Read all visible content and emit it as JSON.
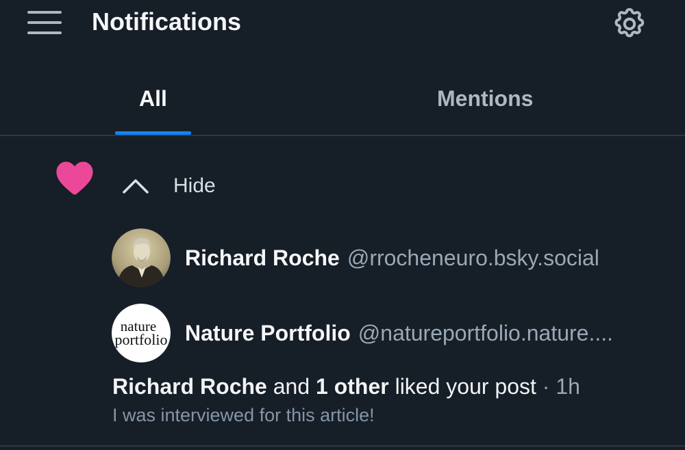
{
  "header": {
    "title": "Notifications",
    "menu_icon": "hamburger-menu-icon",
    "settings_icon": "gear-icon"
  },
  "tabs": [
    {
      "label": "All",
      "active": true
    },
    {
      "label": "Mentions",
      "active": false
    }
  ],
  "notification": {
    "type_icon": "heart-icon",
    "type_color": "#ec4899",
    "toggle": {
      "icon": "chevron-up-icon",
      "label": "Hide"
    },
    "users": [
      {
        "name": "Richard Roche",
        "handle": "@rrocheneuro.bsky.social",
        "avatar": "portrait-photo"
      },
      {
        "name": "Nature Portfolio",
        "handle": "@natureportfolio.nature....",
        "avatar": "nature-portfolio-logo",
        "avatar_text": [
          "nature",
          "portfolio"
        ]
      }
    ],
    "summary": {
      "actor": "Richard Roche",
      "connector": "and",
      "others": "1 other",
      "action": "liked your post",
      "separator": "·",
      "time": "1h"
    },
    "post_excerpt": "I was interviewed for this article!"
  },
  "colors": {
    "background": "#161e27",
    "accent": "#1083fe",
    "muted_text": "#9aa8b6",
    "divider": "#2e3945"
  }
}
